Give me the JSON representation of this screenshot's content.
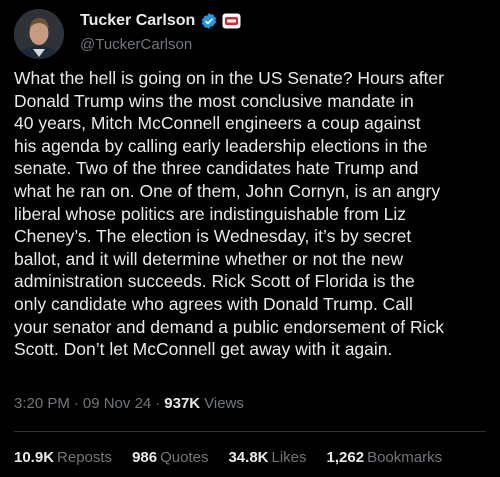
{
  "author": {
    "display_name": "Tucker Carlson",
    "handle": "@TuckerCarlson"
  },
  "tweet": {
    "text": "What the hell is going on in the US Senate? Hours after\nDonald Trump wins the most conclusive mandate in\n40 years, Mitch McConnell engineers a coup against\nhis agenda by calling early leadership elections in the\nsenate. Two of the three candidates hate Trump and\nwhat he ran on. One of them, John Cornyn, is an angry\nliberal whose politics are indistinguishable from Liz\nCheney’s. The election is Wednesday, it’s by secret\nballot, and it will determine whether or not the new\nadministration succeeds. Rick Scott of Florida is the\nonly candidate who agrees with Donald Trump. Call\nyour senator and demand a public endorsement of Rick\nScott. Don’t let McConnell get away with it again."
  },
  "meta": {
    "time": "3:20 PM",
    "date": "09 Nov 24",
    "views": "937K",
    "views_label": "Views",
    "separator": "·"
  },
  "stats": [
    {
      "value": "10.9K",
      "label": "Reposts"
    },
    {
      "value": "986",
      "label": "Quotes"
    },
    {
      "value": "34.8K",
      "label": "Likes"
    },
    {
      "value": "1,262",
      "label": "Bookmarks"
    }
  ],
  "colors": {
    "background": "#000000",
    "text": "#e7e9ea",
    "secondary": "#71767b",
    "verified": "#1d9bf0",
    "divider": "#2f3336"
  },
  "icons": {
    "verified": "verified-badge-icon",
    "affiliation": "affiliation-badge-icon"
  }
}
